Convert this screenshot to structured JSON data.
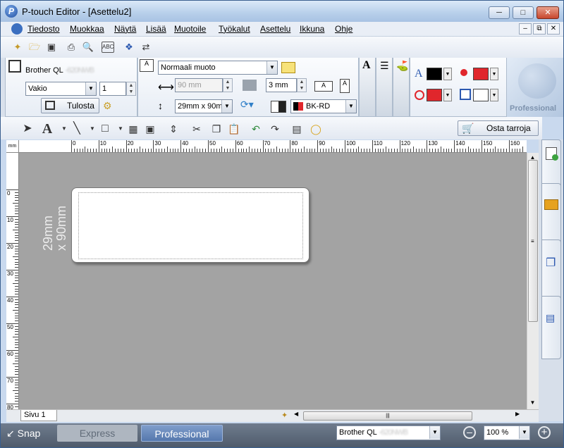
{
  "window": {
    "title": "P-touch Editor - [Asettelu2]",
    "app_icon_glyph": "P"
  },
  "menu": [
    "Tiedosto",
    "Muokkaa",
    "Näytä",
    "Lisää",
    "Muotoile",
    "Työkalut",
    "Asettelu",
    "Ikkuna",
    "Ohje"
  ],
  "printer": {
    "name_prefix": "Brother QL",
    "name_model_obscured": "-620NWB",
    "mode": "Vakio",
    "copies": "1",
    "print_button": "Tulosta"
  },
  "layout": {
    "format": "Normaali muoto",
    "length": "90 mm",
    "margin": "3 mm",
    "media": "29mm x 90m",
    "ribbon_color": "BK-RD"
  },
  "colors": {
    "text_color": "#000000",
    "text_bg_color": "#e0262c",
    "shape_line_color": "#e0262c",
    "shape_fill_color": "#ffffff"
  },
  "brand_badge": "Professional",
  "buy_supplies": "Osta tarroja",
  "canvas": {
    "ruler_unit": "mm",
    "h_ticks": [
      "0",
      "10",
      "20",
      "30",
      "40",
      "50",
      "60",
      "70",
      "80",
      "90",
      "100",
      "110",
      "120",
      "130",
      "140",
      "150",
      "160"
    ],
    "v_ticks": [
      "0",
      "10",
      "20",
      "30",
      "40",
      "50",
      "60",
      "70",
      "80"
    ],
    "label_size_text": "29mm\nx 90mm",
    "page_tab": "Sivu 1"
  },
  "status": {
    "snap": "Snap",
    "express": "Express",
    "professional": "Professional",
    "printer_prefix": "Brother QL",
    "printer_model_obscured": "-620NWB",
    "zoom": "100 %"
  },
  "icons": {
    "toolbar1": [
      "new-icon",
      "open-icon",
      "save-icon",
      "print-icon",
      "preview-icon",
      "spellcheck-icon",
      "wizard-icon",
      "transfer-icon"
    ],
    "toolbar2": [
      "select-arrow-icon",
      "text-icon",
      "line-icon",
      "rectangle-icon",
      "table-icon",
      "frame-icon",
      "align-icon",
      "cut-icon",
      "copy-icon",
      "paste-icon",
      "undo-icon",
      "redo-icon",
      "properties-icon",
      "database-icon",
      "cart-icon"
    ],
    "sidebar": [
      "add-object-icon",
      "folder-icon",
      "layers-icon",
      "pages-icon"
    ]
  }
}
